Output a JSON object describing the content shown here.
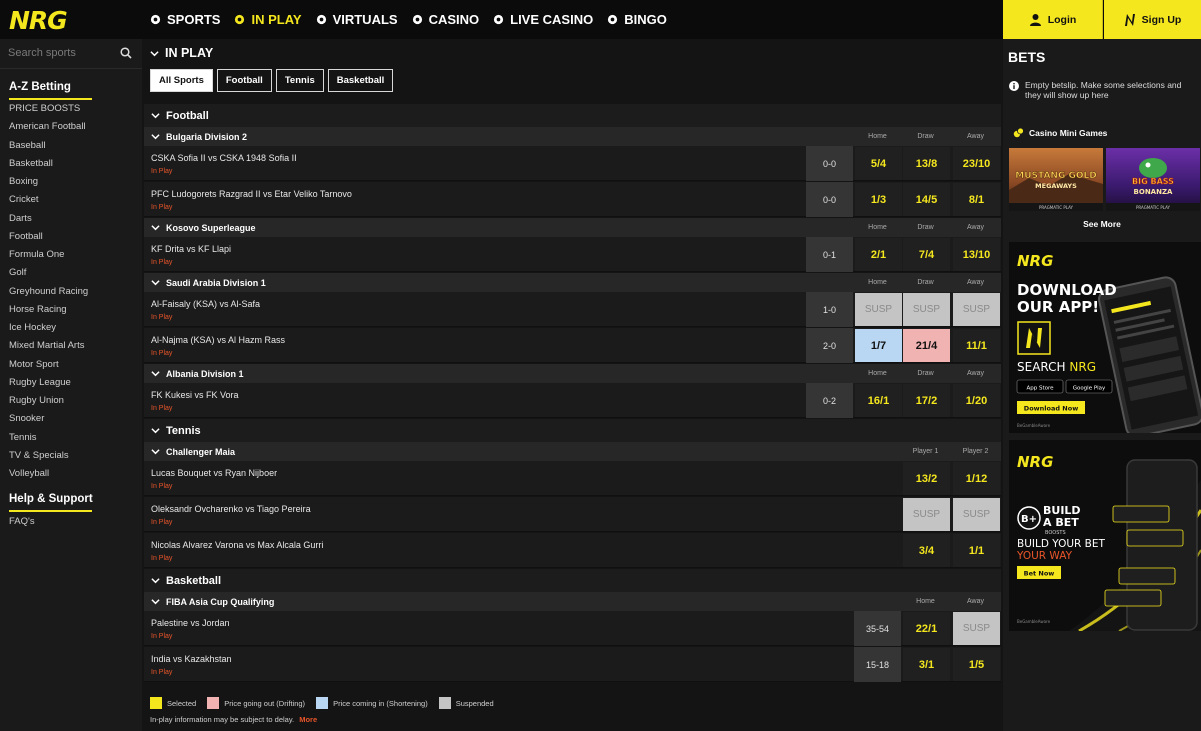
{
  "brand": {
    "logo": "NRG",
    "accent": "#f5e71e",
    "live_color": "#e8552a"
  },
  "nav": [
    {
      "label": "SPORTS",
      "icon": "soccer-ball-icon",
      "active": false
    },
    {
      "label": "IN PLAY",
      "icon": "stopwatch-icon",
      "active": true
    },
    {
      "label": "VIRTUALS",
      "icon": "cube-icon",
      "active": false
    },
    {
      "label": "CASINO",
      "icon": "chips-icon",
      "active": false
    },
    {
      "label": "LIVE CASINO",
      "icon": "dealer-icon",
      "active": false
    },
    {
      "label": "BINGO",
      "icon": "bingo-ball-icon",
      "active": false
    }
  ],
  "auth": {
    "login": "Login",
    "signup": "Sign Up"
  },
  "sidebar": {
    "search_placeholder": "Search sports",
    "az_title": "A-Z Betting",
    "items": [
      "PRICE BOOSTS",
      "American Football",
      "Baseball",
      "Basketball",
      "Boxing",
      "Cricket",
      "Darts",
      "Football",
      "Formula One",
      "Golf",
      "Greyhound Racing",
      "Horse Racing",
      "Ice Hockey",
      "Mixed Martial Arts",
      "Motor Sport",
      "Rugby League",
      "Rugby Union",
      "Snooker",
      "Tennis",
      "TV & Specials",
      "Volleyball"
    ],
    "help_title": "Help & Support",
    "faq": "FAQ's"
  },
  "main": {
    "heading": "IN PLAY",
    "filters": [
      {
        "label": "All Sports",
        "active": true
      },
      {
        "label": "Football",
        "active": false
      },
      {
        "label": "Tennis",
        "active": false
      },
      {
        "label": "Basketball",
        "active": false
      }
    ],
    "sports": [
      {
        "name": "Football",
        "leagues": [
          {
            "name": "Bulgaria Division 2",
            "cols": [
              "Home",
              "Draw",
              "Away"
            ],
            "matches": [
              {
                "teams": "CSKA Sofia II vs CSKA 1948 Sofia II",
                "status": "In Play",
                "score": "0-0",
                "odds": [
                  {
                    "v": "5/4",
                    "s": "n"
                  },
                  {
                    "v": "13/8",
                    "s": "n"
                  },
                  {
                    "v": "23/10",
                    "s": "n"
                  }
                ]
              },
              {
                "teams": "PFC Ludogorets Razgrad II vs Etar Veliko Tarnovo",
                "status": "In Play",
                "score": "0-0",
                "odds": [
                  {
                    "v": "1/3",
                    "s": "n"
                  },
                  {
                    "v": "14/5",
                    "s": "n"
                  },
                  {
                    "v": "8/1",
                    "s": "n"
                  }
                ]
              }
            ]
          },
          {
            "name": "Kosovo Superleague",
            "cols": [
              "Home",
              "Draw",
              "Away"
            ],
            "matches": [
              {
                "teams": "KF Drita vs KF Llapi",
                "status": "In Play",
                "score": "0-1",
                "odds": [
                  {
                    "v": "2/1",
                    "s": "n"
                  },
                  {
                    "v": "7/4",
                    "s": "n"
                  },
                  {
                    "v": "13/10",
                    "s": "n"
                  }
                ]
              }
            ]
          },
          {
            "name": "Saudi Arabia Division 1",
            "cols": [
              "Home",
              "Draw",
              "Away"
            ],
            "matches": [
              {
                "teams": "Al-Faisaly (KSA) vs Al-Safa",
                "status": "In Play",
                "score": "1-0",
                "odds": [
                  {
                    "v": "SUSP",
                    "s": "susp"
                  },
                  {
                    "v": "SUSP",
                    "s": "susp"
                  },
                  {
                    "v": "SUSP",
                    "s": "susp"
                  }
                ]
              },
              {
                "teams": "Al-Najma (KSA) vs Al Hazm Rass",
                "status": "In Play",
                "score": "2-0",
                "odds": [
                  {
                    "v": "1/7",
                    "s": "short"
                  },
                  {
                    "v": "21/4",
                    "s": "drift"
                  },
                  {
                    "v": "11/1",
                    "s": "n"
                  }
                ]
              }
            ]
          },
          {
            "name": "Albania Division 1",
            "cols": [
              "Home",
              "Draw",
              "Away"
            ],
            "matches": [
              {
                "teams": "FK Kukesi vs FK Vora",
                "status": "In Play",
                "score": "0-2",
                "odds": [
                  {
                    "v": "16/1",
                    "s": "n"
                  },
                  {
                    "v": "17/2",
                    "s": "n"
                  },
                  {
                    "v": "1/20",
                    "s": "n"
                  }
                ]
              }
            ]
          }
        ]
      },
      {
        "name": "Tennis",
        "leagues": [
          {
            "name": "Challenger Maia",
            "cols": [
              "Player 1",
              "Player 2"
            ],
            "matches": [
              {
                "teams": "Lucas Bouquet vs Ryan Nijboer",
                "status": "In Play",
                "score": "",
                "odds": [
                  {
                    "v": "13/2",
                    "s": "n"
                  },
                  {
                    "v": "1/12",
                    "s": "n"
                  }
                ]
              },
              {
                "teams": "Oleksandr Ovcharenko vs Tiago Pereira",
                "status": "In Play",
                "score": "",
                "odds": [
                  {
                    "v": "SUSP",
                    "s": "susp"
                  },
                  {
                    "v": "SUSP",
                    "s": "susp"
                  }
                ]
              },
              {
                "teams": "Nicolas Alvarez Varona vs Max Alcala Gurri",
                "status": "In Play",
                "score": "",
                "odds": [
                  {
                    "v": "3/4",
                    "s": "n"
                  },
                  {
                    "v": "1/1",
                    "s": "n"
                  }
                ]
              }
            ]
          }
        ]
      },
      {
        "name": "Basketball",
        "leagues": [
          {
            "name": "FIBA Asia Cup Qualifying",
            "cols": [
              "Home",
              "Away"
            ],
            "matches": [
              {
                "teams": "Palestine vs Jordan",
                "status": "In Play",
                "score": "35-54",
                "odds": [
                  {
                    "v": "22/1",
                    "s": "n"
                  },
                  {
                    "v": "SUSP",
                    "s": "susp"
                  }
                ]
              },
              {
                "teams": "India vs Kazakhstan",
                "status": "In Play",
                "score": "15-18",
                "odds": [
                  {
                    "v": "3/1",
                    "s": "n"
                  },
                  {
                    "v": "1/5",
                    "s": "n"
                  }
                ]
              }
            ]
          }
        ]
      }
    ],
    "legend": [
      {
        "label": "Selected",
        "color": "#f5e71e"
      },
      {
        "label": "Price going out (Drifting)",
        "color": "#f1b2b2"
      },
      {
        "label": "Price coming in (Shortening)",
        "color": "#b9d6f2"
      },
      {
        "label": "Suspended",
        "color": "#c4c4c4"
      }
    ],
    "disclaimer": "In-play information may be subject to delay.",
    "more_link": "More"
  },
  "betslip": {
    "title": "BETS",
    "empty_text": "Empty betslip. Make some selections and they will show up here",
    "casino_title": "Casino Mini Games",
    "games": [
      {
        "title_line1": "MUSTANG GOLD",
        "title_line2": "MEGAWAYS",
        "provider": "PRAGMATIC PLAY"
      },
      {
        "title_line1": "BIG BASS",
        "title_line2": "BONANZA",
        "provider": "PRAGMATIC PLAY"
      }
    ],
    "see_more": "See More",
    "promo1": {
      "brand": "NRG",
      "line1": "DOWNLOAD",
      "line2": "OUR APP!",
      "search_label": "SEARCH ",
      "search_brand": "NRG",
      "store1": "App Store",
      "store2": "Google Play",
      "cta": "Download Now",
      "footer": "BeGambleAware"
    },
    "promo2": {
      "brand": "NRG",
      "badge": "B+",
      "line1": "BUILD",
      "line2": "A BET",
      "sub": "BOOSTS",
      "tag1": "BUILD YOUR BET",
      "tag2": "YOUR WAY",
      "cta": "Bet Now",
      "footer": "BeGambleAware"
    }
  }
}
